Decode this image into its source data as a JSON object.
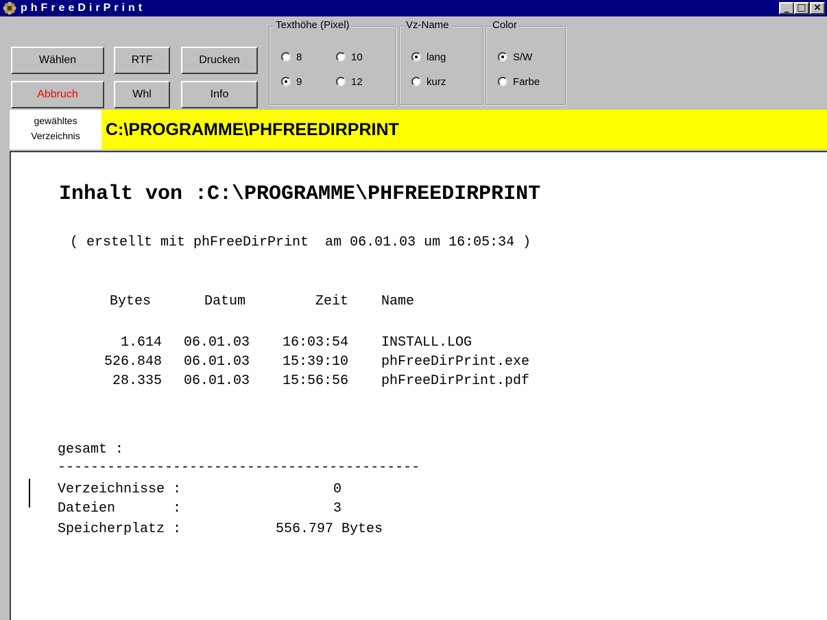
{
  "window": {
    "title": "phFreeDirPrint",
    "minimize_glyph": "_",
    "maximize_glyph": "□",
    "close_glyph": "×"
  },
  "toolbar": {
    "buttons": {
      "waehlen": "Wählen",
      "rtf": "RTF",
      "drucken": "Drucken",
      "abbruch": "Abbruch",
      "whl": "Whl",
      "info": "Info"
    },
    "groups": {
      "texthoehe": {
        "label": "Texthöhe (Pixel)",
        "options": [
          "8",
          "10",
          "9",
          "12"
        ],
        "selected": "9"
      },
      "vzname": {
        "label": "Vz-Name",
        "options": [
          "lang",
          "kurz"
        ],
        "selected": "lang"
      },
      "color": {
        "label": "Color",
        "options": [
          "S/W",
          "Farbe"
        ],
        "selected": "S/W"
      }
    }
  },
  "directory": {
    "label_line1": "gewähltes",
    "label_line2": "Verzeichnis",
    "value": "C:\\PROGRAMME\\PHFREEDIRPRINT"
  },
  "listing": {
    "heading": "Inhalt von :C:\\PROGRAMME\\PHFREEDIRPRINT",
    "created": "( erstellt mit phFreeDirPrint  am 06.01.03 um 16:05:34 )",
    "columns": [
      "Bytes",
      "Datum",
      "Zeit",
      "Name"
    ],
    "rows": [
      {
        "bytes": "1.614",
        "date": "06.01.03",
        "time": "16:03:54",
        "name": "INSTALL.LOG"
      },
      {
        "bytes": "526.848",
        "date": "06.01.03",
        "time": "15:39:10",
        "name": "phFreeDirPrint.exe"
      },
      {
        "bytes": "28.335",
        "date": "06.01.03",
        "time": "15:56:56",
        "name": "phFreeDirPrint.pdf"
      }
    ],
    "total_label": "gesamt :",
    "separator": "--------------------------------------------",
    "summary": [
      {
        "label": "Verzeichnisse :",
        "value": "0"
      },
      {
        "label": "Dateien       :",
        "value": "3"
      },
      {
        "label": "Speicherplatz :",
        "value": "556.797 Bytes"
      }
    ]
  }
}
